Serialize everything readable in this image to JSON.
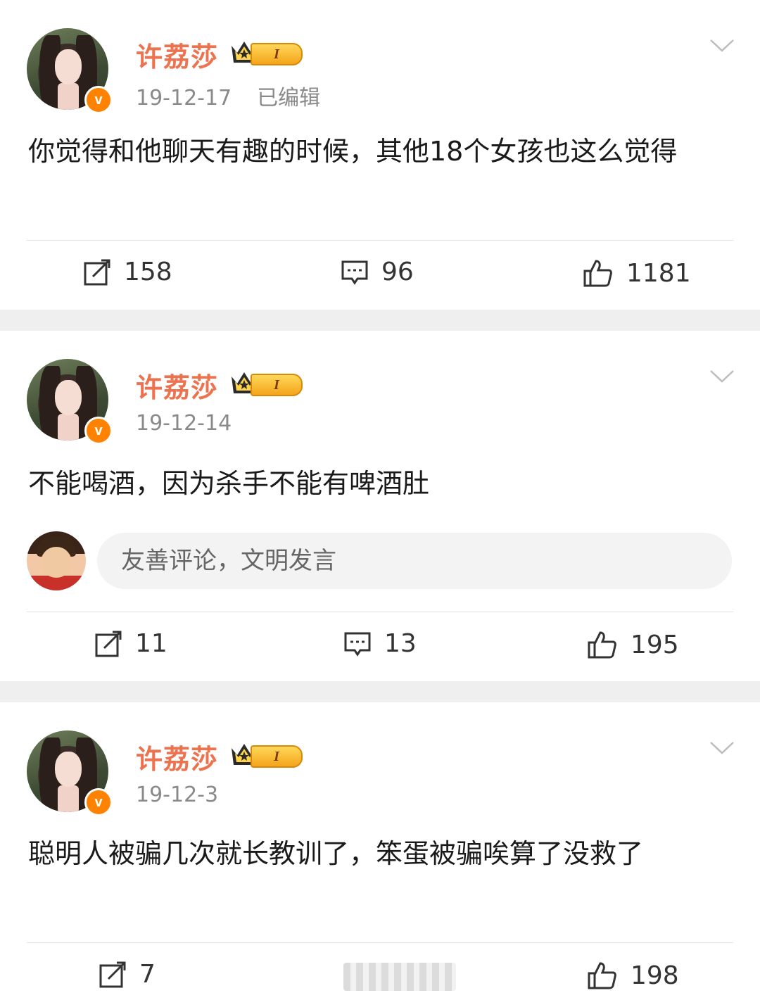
{
  "posts": [
    {
      "author": "许荔莎",
      "vip_level": "I",
      "verified_badge": "v",
      "date": "19-12-17",
      "edited": "已编辑",
      "text": "你觉得和他聊天有趣的时候，其他18个女孩也这么觉得",
      "reposts": "158",
      "comments": "96",
      "likes": "1181"
    },
    {
      "author": "许荔莎",
      "vip_level": "I",
      "verified_badge": "v",
      "date": "19-12-14",
      "text": "不能喝酒，因为杀手不能有啤酒肚",
      "comment_placeholder": "友善评论，文明发言",
      "reposts": "11",
      "comments": "13",
      "likes": "195"
    },
    {
      "author": "许荔莎",
      "vip_level": "I",
      "verified_badge": "v",
      "date": "19-12-3",
      "text": "聪明人被骗几次就长教训了，笨蛋被骗唉算了没救了",
      "reposts": "7",
      "likes": "198"
    }
  ],
  "icons": {
    "repost": "repost-icon",
    "comment": "comment-icon",
    "like": "thumbs-up-icon",
    "more": "chevron-down-icon",
    "vip": "crown-icon"
  },
  "colors": {
    "author_name": "#eb7350",
    "verified": "#ff8200",
    "meta": "#8a8a8a",
    "separator": "#efefef"
  }
}
